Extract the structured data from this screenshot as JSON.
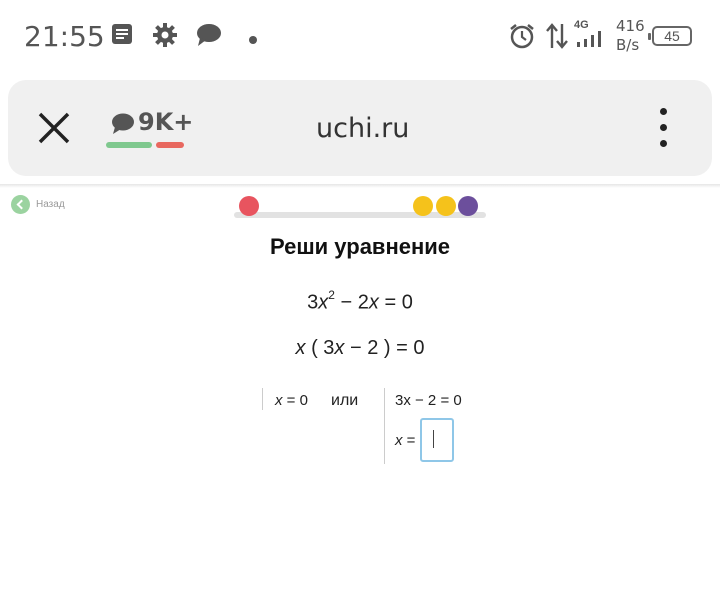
{
  "status_bar": {
    "time": "21:55",
    "network_type": "4G",
    "speed_value": "416",
    "speed_unit": "B/s",
    "battery": "45",
    "icons": [
      "notes-icon",
      "settings-gear-icon",
      "chat-bubble-icon",
      "dot-icon",
      "alarm-icon",
      "data-arrows-icon",
      "signal-icon",
      "battery-icon"
    ]
  },
  "browser": {
    "comments_count": "9K+",
    "url": "uchi.ru"
  },
  "page": {
    "back_label": "Назад",
    "progress_dot_colors": [
      "#e8545f",
      "#f5c21b",
      "#f5c21b",
      "#6c4f9c"
    ],
    "title": "Реши уравнение",
    "equation1": {
      "coef": "3",
      "var": "x",
      "power": "2",
      "rest": " − 2",
      "var2": "x",
      "rhs": " = 0"
    },
    "equation2": {
      "var": "x",
      "open": " ( 3",
      "var2": "x",
      "rest": " − 2 ) = 0"
    },
    "left_solution": {
      "var": "x",
      "rest": " = 0"
    },
    "or_label": "или",
    "right_solution": {
      "line1": "3x − 2 = 0",
      "var": "x",
      "eq": " ="
    },
    "answer_value": ""
  }
}
